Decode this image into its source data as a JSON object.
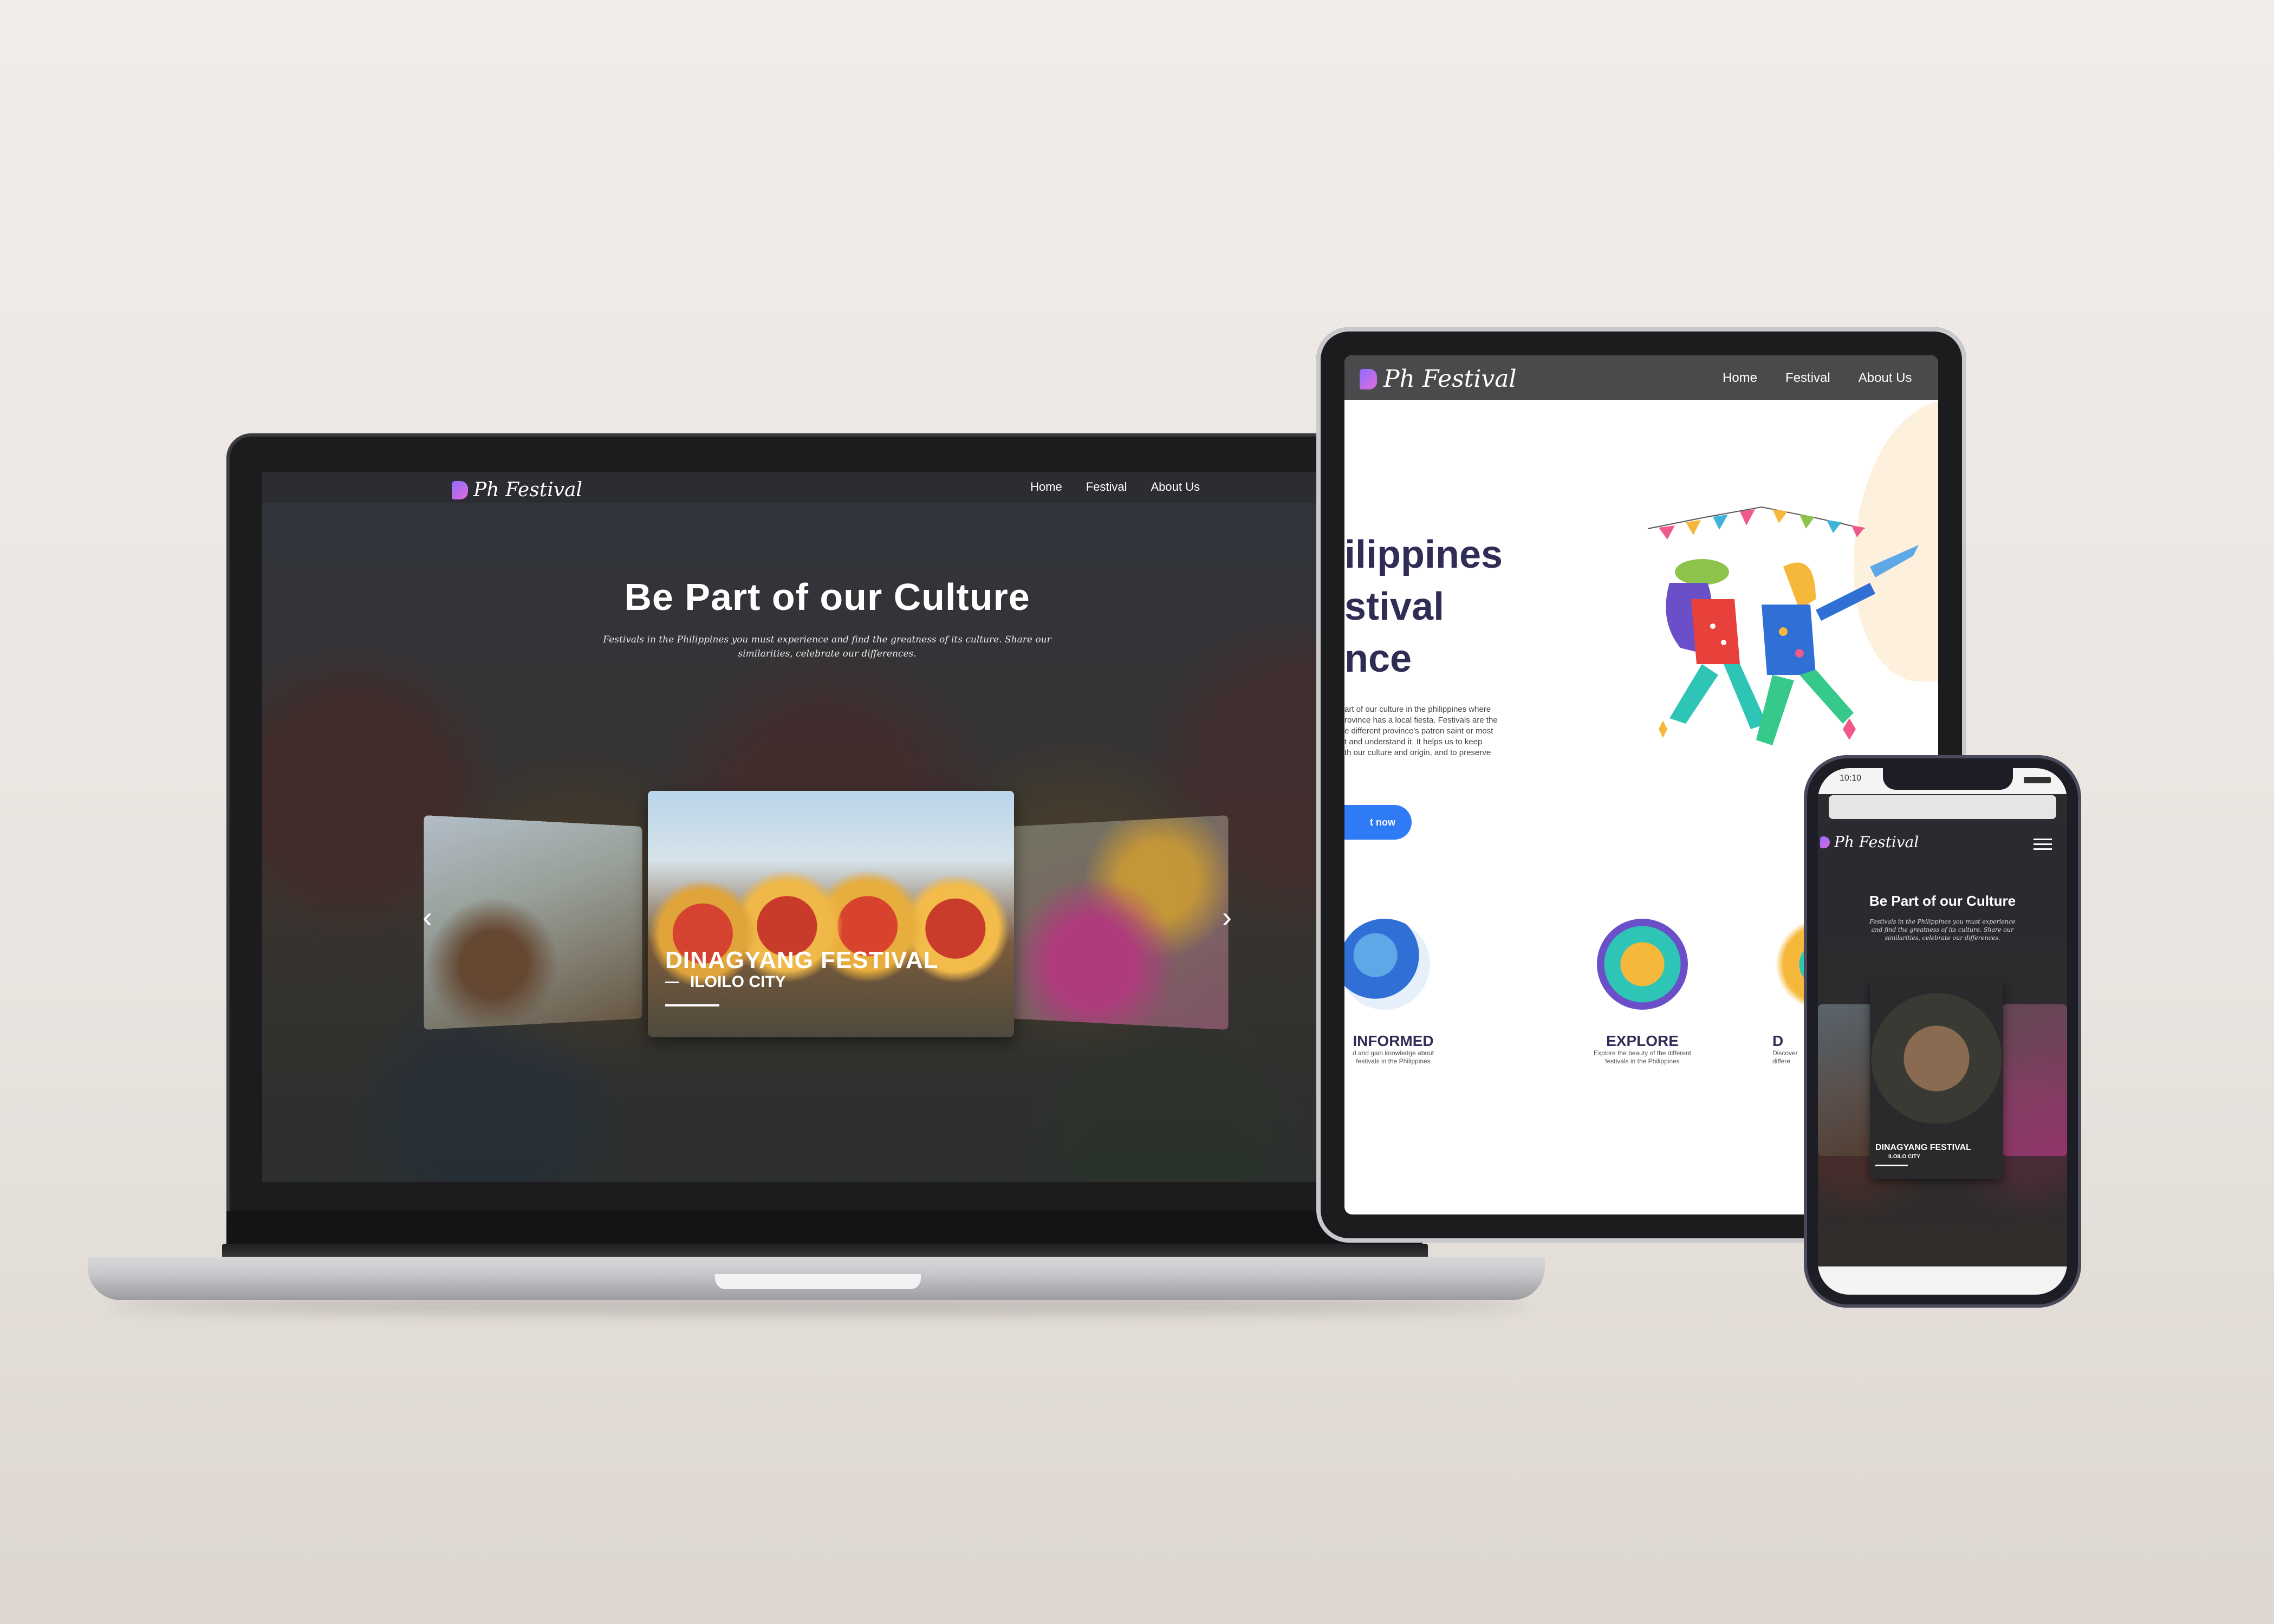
{
  "desktop": {
    "brand": "Ph Festival",
    "nav": [
      "Home",
      "Festival",
      "About Us"
    ],
    "hero_title": "Be Part of our Culture",
    "hero_subtitle_line1": "Festivals in the Philippines you must experience and find the greatness of its culture. Share our",
    "hero_subtitle_line2": "similarities, celebrate our differences.",
    "carousel": {
      "prev_icon": "chevron-left-icon",
      "next_icon": "chevron-right-icon",
      "prev_glyph": "‹",
      "next_glyph": "›",
      "active_title": "DINAGYANG FESTIVAL",
      "active_location": "ILOILO CITY"
    }
  },
  "tablet": {
    "brand": "Ph Festival",
    "nav": [
      "Home",
      "Festival",
      "About Us"
    ],
    "heading_line1": "ilippines",
    "heading_line2": "stival",
    "heading_line3": "nce",
    "body_lines": [
      "art of our culture in the philippines where",
      "rovince has a local fiesta. Festivals are the",
      "e different province's patron saint or most",
      "t and understand it. It helps us to keep",
      "th our culture and origin, and to preserve"
    ],
    "cta_label": "t now",
    "features": [
      {
        "title": "INFORMED",
        "line1": "d and gain knowledge about",
        "line2": "festivals in the Philippines"
      },
      {
        "title": "EXPLORE",
        "line1": "Explore the beauty of the different",
        "line2": "festivals in the Philippines"
      },
      {
        "title": "D",
        "line1": "Discover",
        "line2": "differe"
      }
    ]
  },
  "phone": {
    "time": "10:10",
    "brand": "Ph Festival",
    "menu_icon": "hamburger-menu-icon",
    "hero_title": "Be Part of our Culture",
    "hero_subtitle_line1": "Festivals in the Philippines you must experience",
    "hero_subtitle_line2": "and find the greatness of its culture. Share our",
    "hero_subtitle_line3": "similarities, celebrate our differences.",
    "card_title": "DINAGYANG FESTIVAL",
    "card_location": "ILOILO CITY"
  },
  "colors": {
    "accent_blue": "#2f7bf5",
    "heading_navy": "#2f2d55",
    "logo_gradient_start": "#8c6cff",
    "logo_gradient_end": "#e46bd8"
  }
}
